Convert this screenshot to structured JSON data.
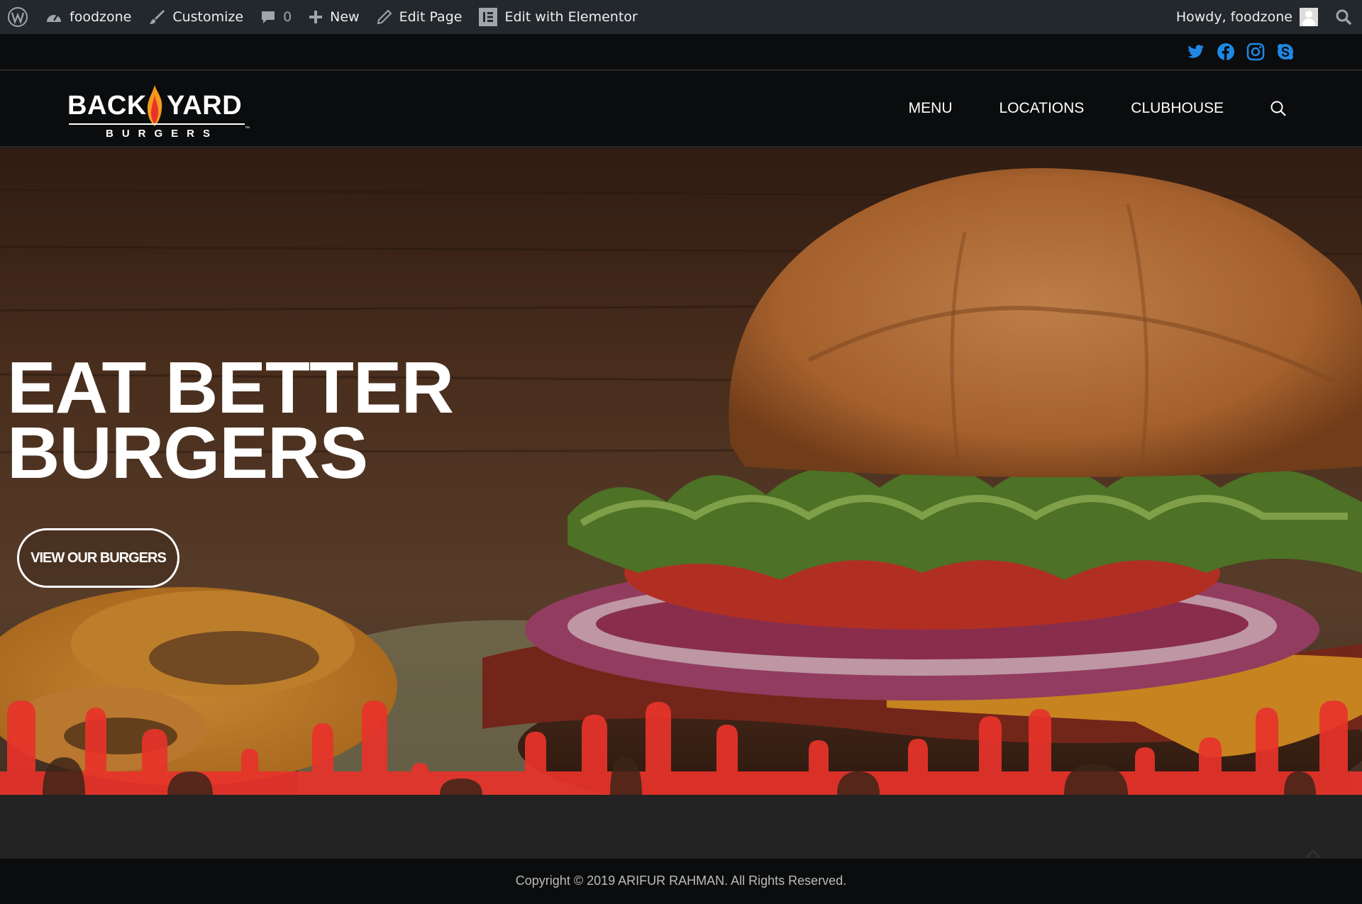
{
  "adminbar": {
    "site_name": "foodzone",
    "customize": "Customize",
    "comments_count": "0",
    "new_label": "New",
    "edit_page": "Edit Page",
    "edit_elementor": "Edit with Elementor",
    "howdy": "Howdy, foodzone"
  },
  "social": {
    "icons": [
      "twitter-icon",
      "facebook-icon",
      "instagram-icon",
      "skype-icon"
    ],
    "color": "#1e88e5"
  },
  "logo": {
    "word_left": "BACK",
    "word_right": "YARD",
    "subtitle": "BURGERS",
    "trademark": "™"
  },
  "nav": {
    "items": [
      "MENU",
      "LOCATIONS",
      "CLUBHOUSE"
    ]
  },
  "hero": {
    "title_line1": "EAT BETTER",
    "title_line2": "BURGERS",
    "button": "VIEW OUR BURGERS"
  },
  "footer": {
    "copyright": "Copyright © 2019 ARIFUR RAHMAN. All Rights Reserved."
  },
  "colors": {
    "adminbar": "#23282d",
    "header": "#0b0c0d",
    "drip": "#e8332a",
    "band": "#232323"
  }
}
